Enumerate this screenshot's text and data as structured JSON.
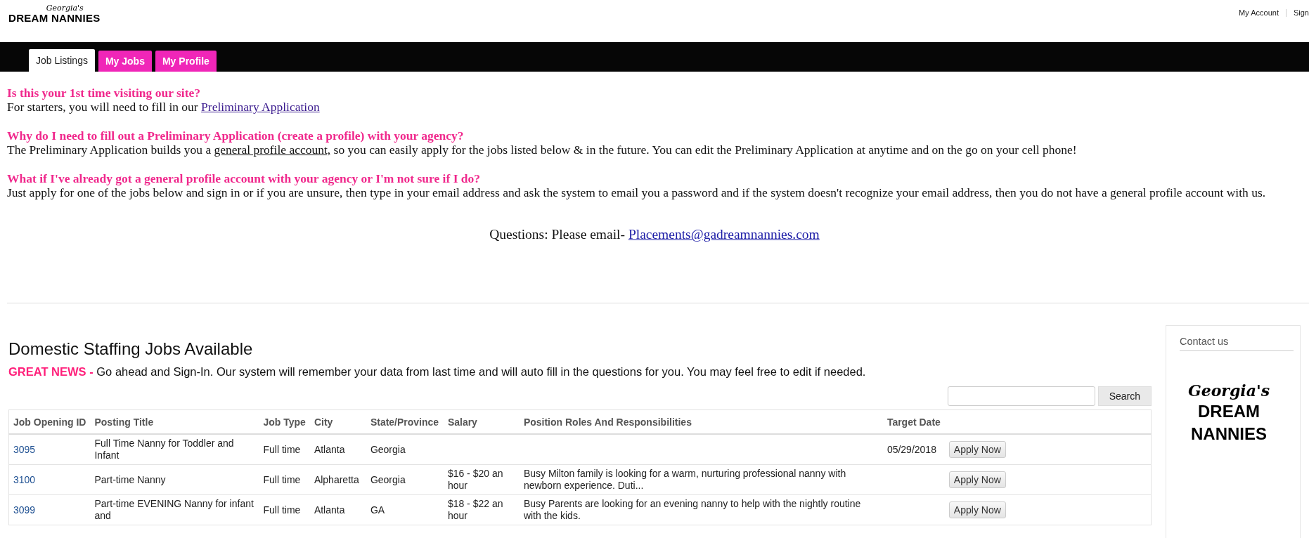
{
  "header": {
    "logo": {
      "script": "Georgia's",
      "name": "DREAM NANNIES"
    },
    "account_links": [
      "My Account",
      "Sign"
    ]
  },
  "tabs": [
    {
      "label": "Job Listings",
      "selected": true
    },
    {
      "label": "My Jobs",
      "selected": false
    },
    {
      "label": "My Profile",
      "selected": false
    }
  ],
  "intro": {
    "sections": [
      {
        "heading": "Is this your 1st time visiting our site?",
        "parts": [
          {
            "kind": "plain",
            "text": "For starters, you will need to fill in our "
          },
          {
            "kind": "link",
            "text": "Preliminary Application"
          }
        ]
      },
      {
        "heading": "Why do I need to fill out a Preliminary Application (create a profile) with your agency?",
        "parts": [
          {
            "kind": "plain",
            "text": "The Preliminary Application builds you a "
          },
          {
            "kind": "underline",
            "text": "general profile account,"
          },
          {
            "kind": "plain",
            "text": " so you can easily apply for the jobs listed below & in the future. You can edit the Preliminary Application at anytime and on the go on your cell phone!"
          }
        ]
      },
      {
        "heading": "What if I've already got a general profile account with your agency or I'm not sure if I do?",
        "parts": [
          {
            "kind": "plain",
            "text": "Just apply for one of the jobs below and sign in or if you are unsure, then type in your email address and ask the system to email you a password and if the system doesn't recognize your email address, then you do not have a general profile account with us."
          }
        ]
      }
    ],
    "questions": {
      "label": "Questions: Please email-",
      "email": "Placements@gadreamnannies.com"
    }
  },
  "jobs": {
    "title": "Domestic Staffing Jobs Available",
    "notice": {
      "highlight": "GREAT NEWS -",
      "text": "Go ahead and Sign-In. Our system will remember your data from last time and will auto fill in the questions for you. You may feel free to edit if needed."
    },
    "search": {
      "button": "Search"
    },
    "table": {
      "columns": [
        "Job Opening ID",
        "Posting Title",
        "Job Type",
        "City",
        "State/Province",
        "Salary",
        "Position Roles And Responsibilities",
        "Target Date"
      ],
      "rows": [
        {
          "id": "3095",
          "title": "Full Time Nanny for Toddler and Infant",
          "job_type": "Full time",
          "city": "Atlanta",
          "state": "Georgia",
          "salary": "",
          "description": "",
          "target_date": "05/29/2018",
          "action": "Apply Now"
        },
        {
          "id": "3100",
          "title": "Part-time Nanny",
          "job_type": "Full time",
          "city": "Alpharetta",
          "state": "Georgia",
          "salary": "$16 - $20 an hour",
          "description": "Busy Milton family is looking for a warm, nurturing professional nanny with newborn experience. Duti...",
          "target_date": "",
          "action": "Apply Now"
        },
        {
          "id": "3099",
          "title": "Part-time EVENING Nanny for infant and",
          "job_type": "Full time",
          "city": "Atlanta",
          "state": "GA",
          "salary": "$18 - $22 an hour",
          "description": "Busy Parents are looking for an evening nanny to help with the nightly routine with the kids.",
          "target_date": "",
          "action": "Apply Now"
        }
      ]
    }
  },
  "sidebar": {
    "title": "Contact us",
    "logo": {
      "script": "Georgia's",
      "lines": [
        "DREAM",
        "NANNIES"
      ]
    }
  }
}
